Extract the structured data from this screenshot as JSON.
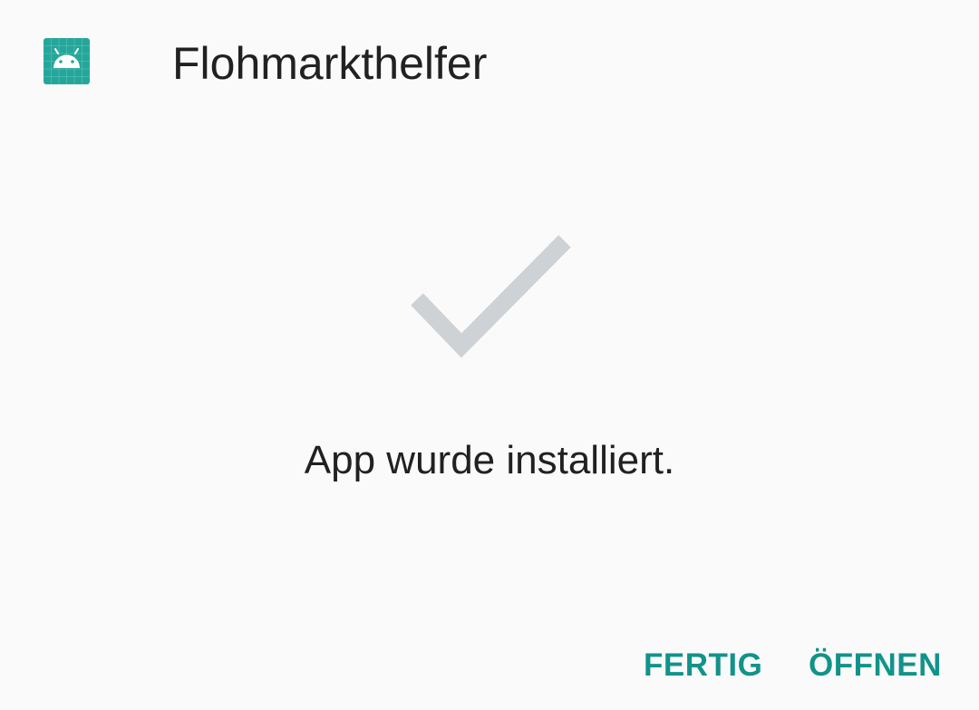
{
  "header": {
    "app_icon": "android-robot-icon",
    "app_name": "Flohmarkthelfer"
  },
  "status": {
    "icon": "checkmark-icon",
    "message": "App wurde installiert."
  },
  "actions": {
    "done_label": "FERTIG",
    "open_label": "ÖFFNEN"
  },
  "colors": {
    "accent": "#12938a",
    "icon_background": "#26a69a",
    "checkmark": "#cfd2d4",
    "background": "#fafafa",
    "text": "#212121"
  }
}
